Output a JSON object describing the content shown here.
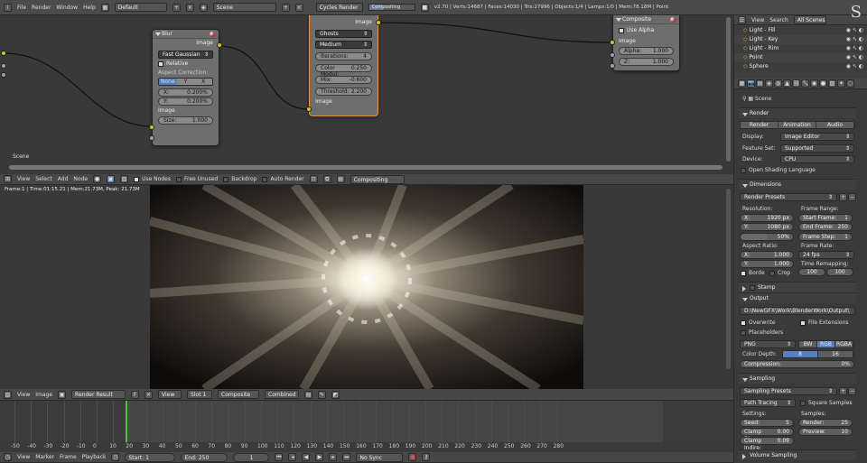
{
  "topbar": {
    "menus": [
      "File",
      "Render",
      "Window",
      "Help"
    ],
    "layout": "Default",
    "scene": "Scene",
    "engine": "Cycles Render",
    "progress_label": "Compositing",
    "stats": "v2.70 | Verts:14687 | Faces:14030 | Tris:27996 | Objects:1/4 | Lamps:1/0 | Mem:78.18M | Point"
  },
  "node_editor": {
    "scene_label": "Scene",
    "blur": {
      "title": "Blur",
      "out": "Image",
      "filter": "Fast Gaussian",
      "relative": "Relative",
      "aspect": "Aspect Correction:",
      "aspect_opts": [
        "None",
        "Y",
        "X"
      ],
      "x_label": "X:",
      "x_val": "0.200%",
      "y_label": "Y:",
      "y_val": "0.200%",
      "in_image": "Image",
      "size_label": "Size:",
      "size_val": "1.000"
    },
    "glare": {
      "out": "Image",
      "type": "Ghosts",
      "quality": "Medium",
      "iter_label": "Iterations:",
      "iter_val": "4",
      "color_label": "Color Modul:",
      "color_val": "0.250",
      "mix_label": "Mix:",
      "mix_val": "-0.600",
      "thr_label": "Threshold:",
      "thr_val": "2.200",
      "in_image": "Image"
    },
    "composite": {
      "title": "Composite",
      "use_alpha": "Use Alpha",
      "image": "Image",
      "alpha_label": "Alpha:",
      "alpha_val": "1.000",
      "z_label": "Z:",
      "z_val": "1.000"
    }
  },
  "node_header": {
    "menus": [
      "View",
      "Select",
      "Add",
      "Node"
    ],
    "use_nodes": "Use Nodes",
    "free_unused": "Free Unused",
    "backdrop": "Backdrop",
    "auto_render": "Auto Render",
    "tree": "Compositing"
  },
  "image_editor": {
    "info": "Frame:1 | Time:01:15.21 | Mem:21.73M, Peak: 21.73M",
    "menus": [
      "View",
      "Image"
    ],
    "image_name": "Render Result",
    "view": "View",
    "slot": "Slot 1",
    "layer": "Composite",
    "pass": "Combined"
  },
  "timeline": {
    "ticks": [
      "-50",
      "-40",
      "-30",
      "-20",
      "-10",
      "0",
      "10",
      "20",
      "30",
      "40",
      "50",
      "60",
      "70",
      "80",
      "90",
      "100",
      "110",
      "120",
      "130",
      "140",
      "150",
      "160",
      "170",
      "180",
      "190",
      "200",
      "210",
      "220",
      "230",
      "240",
      "250",
      "260",
      "270",
      "280"
    ],
    "menus": [
      "View",
      "Marker",
      "Frame",
      "Playback"
    ],
    "start_label": "Start:",
    "start_val": "1",
    "end_label": "End:",
    "end_val": "250",
    "current": "1",
    "sync": "No Sync"
  },
  "outliner": {
    "menus": [
      "View",
      "Search"
    ],
    "scenes": "All Scenes",
    "items": [
      "Light - Fill",
      "Light - Key",
      "Light - Rim",
      "Point",
      "Sphere"
    ]
  },
  "properties": {
    "context": "Scene",
    "render": {
      "header": "Render",
      "buttons": [
        "Render",
        "Animation",
        "Audio"
      ],
      "display_label": "Display:",
      "display": "Image Editor",
      "feature_label": "Feature Set:",
      "feature": "Supported",
      "device_label": "Device:",
      "device": "CPU",
      "osl": "Open Shading Language"
    },
    "dimensions": {
      "header": "Dimensions",
      "presets": "Render Presets",
      "res_label": "Resolution:",
      "x_label": "X:",
      "x_val": "1920 px",
      "y_label": "Y:",
      "y_val": "1080 px",
      "pct": "50%",
      "frange_label": "Frame Range:",
      "start_label": "Start Frame:",
      "start_val": "1",
      "end_label": "End Frame:",
      "end_val": "250",
      "step_label": "Frame Step:",
      "step_val": "1",
      "aspect_label": "Aspect Ratio:",
      "ax_label": "X:",
      "ax_val": "1.000",
      "ay_label": "Y:",
      "ay_val": "1.000",
      "rate_label": "Frame Rate:",
      "rate": "24 fps",
      "remap_label": "Time Remapping:",
      "remap_old": "100",
      "remap_new": "100",
      "border": "Borde",
      "crop": "Crop"
    },
    "stamp": {
      "header": "Stamp"
    },
    "output": {
      "header": "Output",
      "path": "D:\\NewGFX\\Work\\BlenderWork\\Output\\",
      "overwrite": "Overwrite",
      "file_ext": "File Extensions",
      "placeholders": "Placeholders",
      "format": "PNG",
      "modes": [
        "BW",
        "RGB",
        "RGBA"
      ],
      "depth_label": "Color Depth:",
      "depths": [
        "8",
        "16"
      ],
      "compression": "Compression:",
      "compression_val": "0%"
    },
    "sampling": {
      "header": "Sampling",
      "presets": "Sampling Presets",
      "method": "Path Tracing",
      "square": "Square Samples",
      "settings": "Settings:",
      "samples": "Samples:",
      "seed_label": "Seed:",
      "seed_val": "5",
      "render_label": "Render:",
      "render_val": "25",
      "cdirect_label": "Clamp Direc:",
      "cdirect_val": "0.00",
      "preview_label": "Preview:",
      "preview_val": "10",
      "cindirect_label": "Clamp Indire:",
      "cindirect_val": "0.09"
    },
    "volume": {
      "header": "Volume Sampling"
    }
  }
}
